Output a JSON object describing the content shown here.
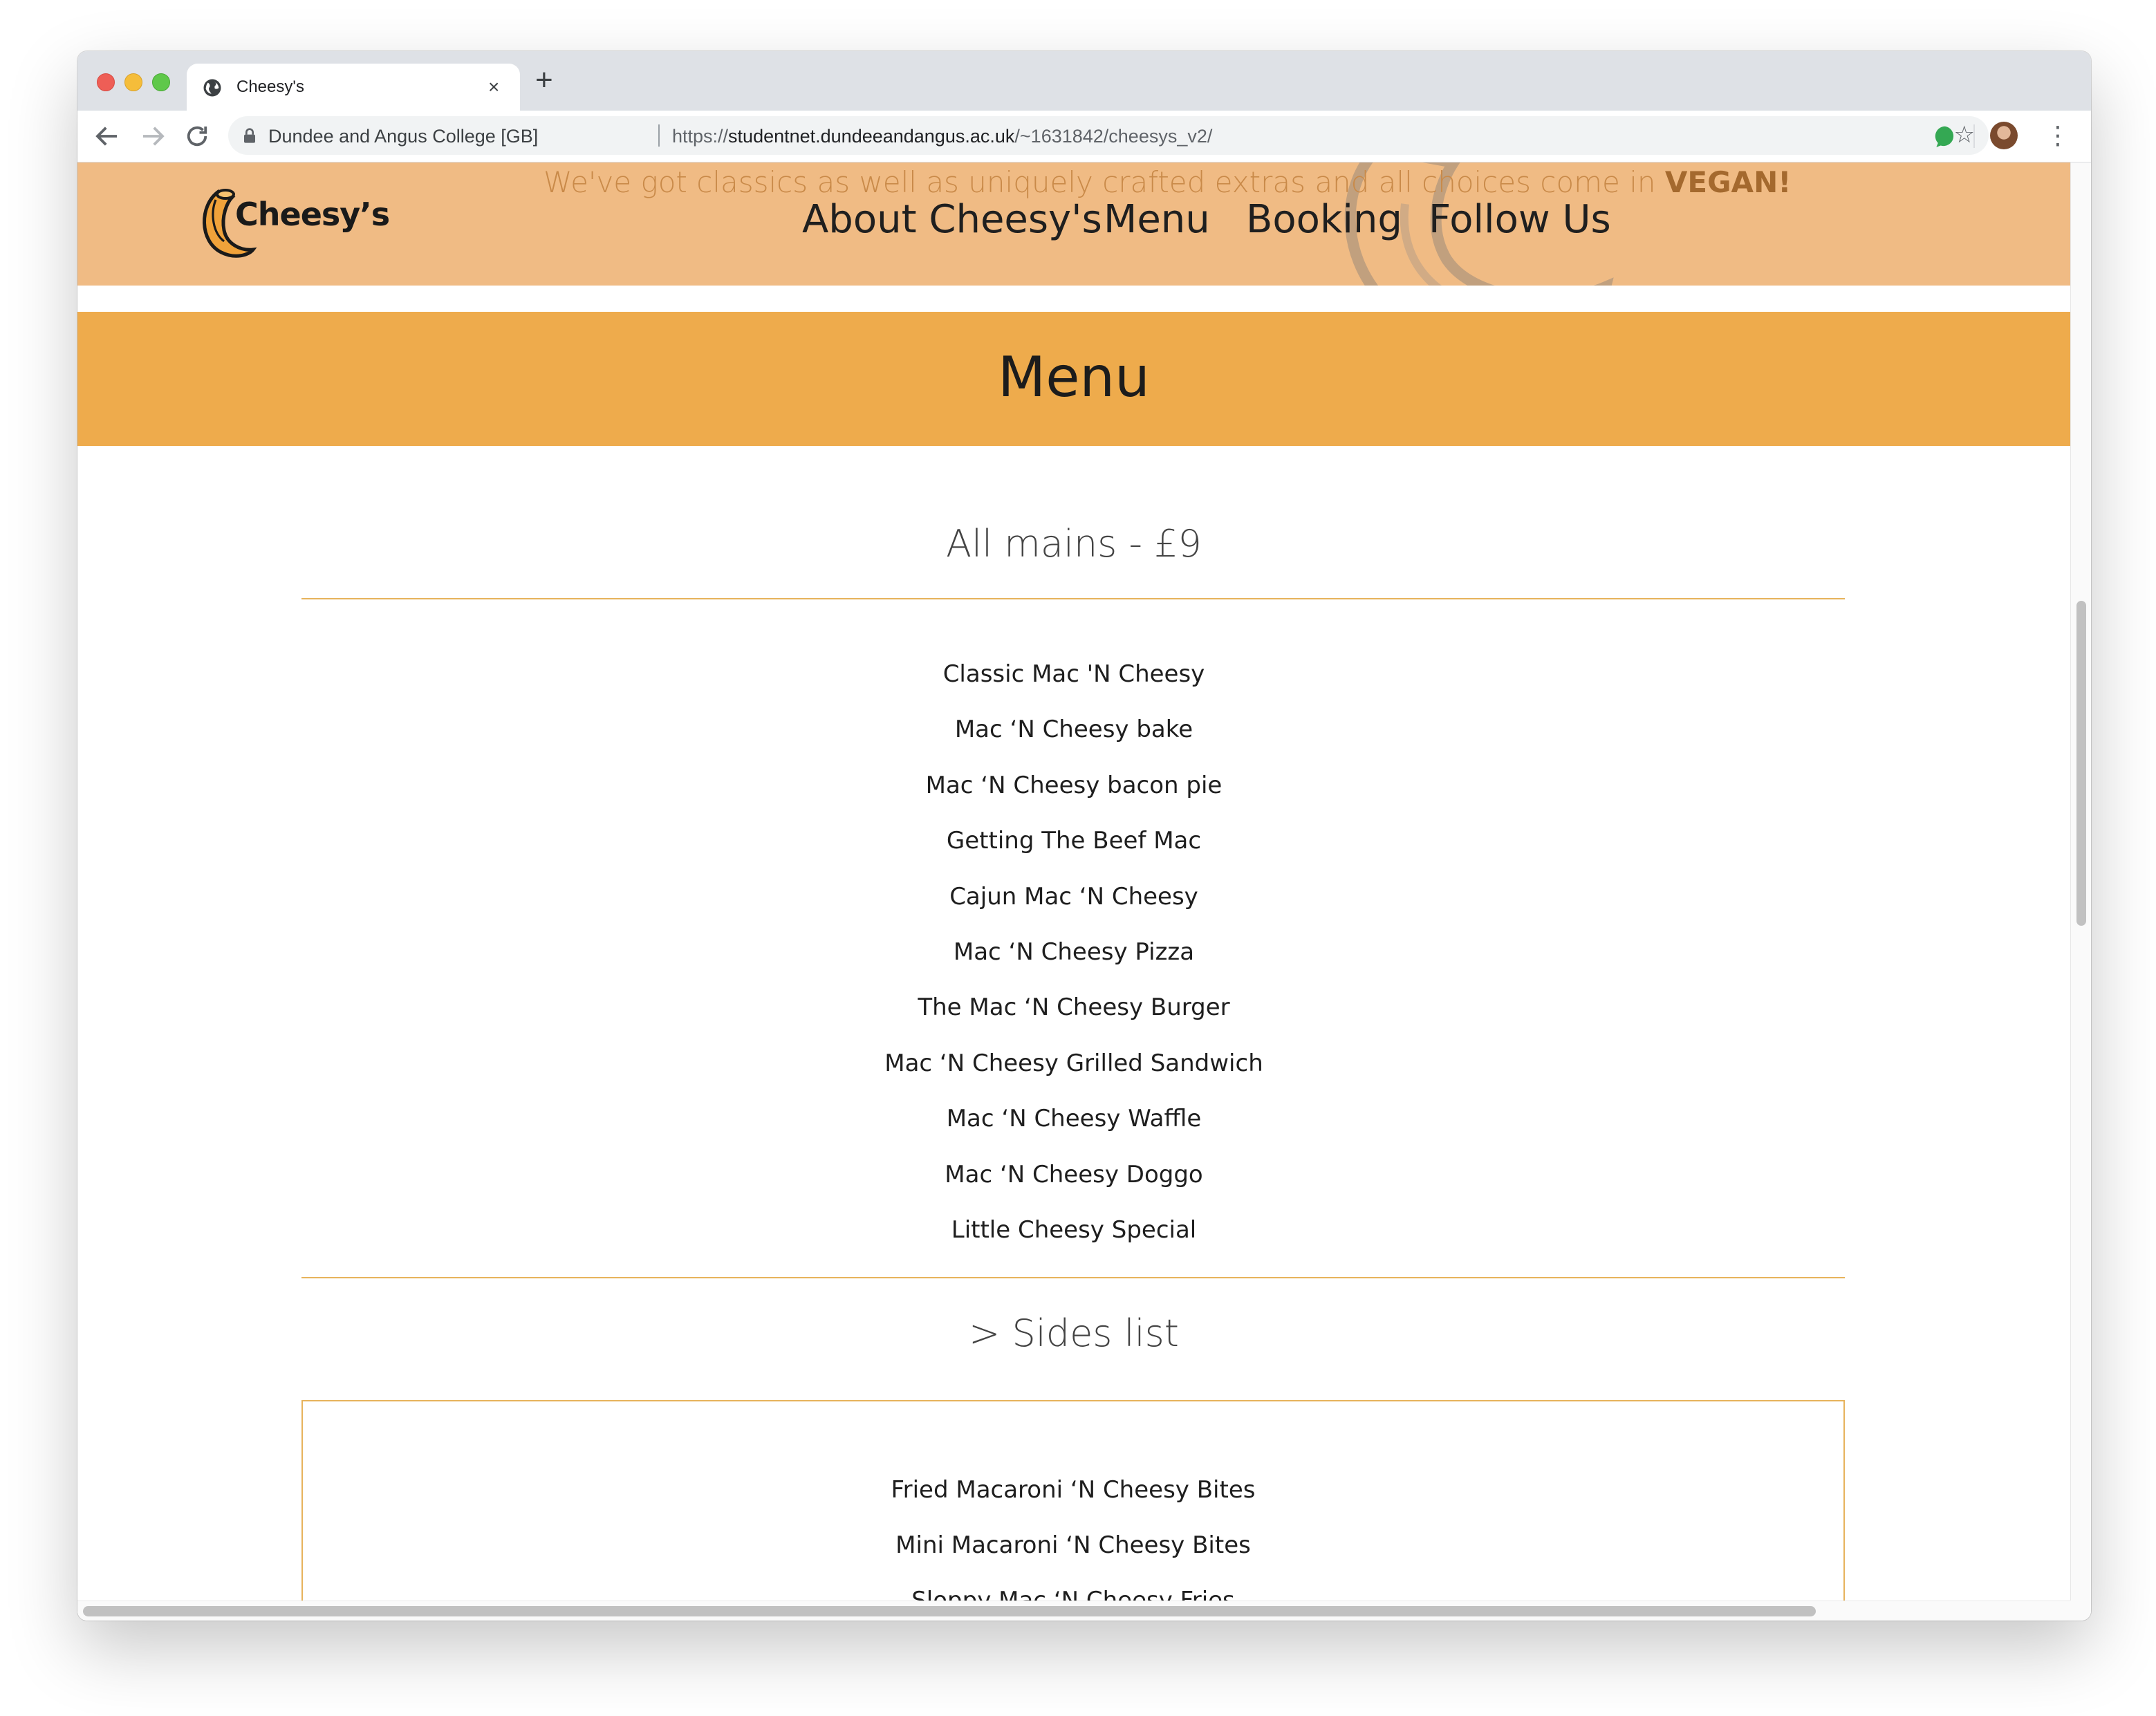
{
  "browser": {
    "tab_title": "Cheesy's",
    "tab_close": "×",
    "new_tab": "+",
    "site_name": "Dundee and Angus College [GB]",
    "url_scheme": "https://",
    "url_host": "studentnet.dundeeandangus.ac.uk",
    "url_path": "/~1631842/cheesys_v2/",
    "bookmark_icon": "☆",
    "menu_icon": "⋮"
  },
  "header": {
    "logo_text": "Cheesy’s",
    "tagline_prefix": "We've got classics as well as uniquely crafted extras and all choices come in ",
    "tagline_emphasis": "VEGAN!",
    "nav": [
      "About Cheesy's",
      "Menu",
      "Booking",
      "Follow Us"
    ],
    "colors": {
      "header_bg": "#f0bb84",
      "banner_bg": "#eeab4c",
      "rule": "#e7b35c"
    }
  },
  "banner": {
    "title": "Menu"
  },
  "mains": {
    "title": "All mains - £9",
    "items": [
      "Classic Mac 'N Cheesy",
      "Mac ‘N Cheesy bake",
      "Mac ‘N Cheesy bacon pie",
      "Getting The Beef Mac",
      "Cajun Mac ‘N Cheesy",
      "Mac ‘N Cheesy Pizza",
      "The Mac ‘N Cheesy Burger",
      "Mac ‘N Cheesy Grilled Sandwich",
      "Mac ‘N Cheesy Waffle",
      "Mac ‘N Cheesy Doggo",
      "Little Cheesy Special"
    ]
  },
  "sides": {
    "title": "> Sides list",
    "items": [
      "Fried Macaroni ‘N Cheesy Bites",
      "Mini Macaroni ‘N Cheesy Bites",
      "Sloppy Mac ‘N Cheesy Fries"
    ]
  }
}
